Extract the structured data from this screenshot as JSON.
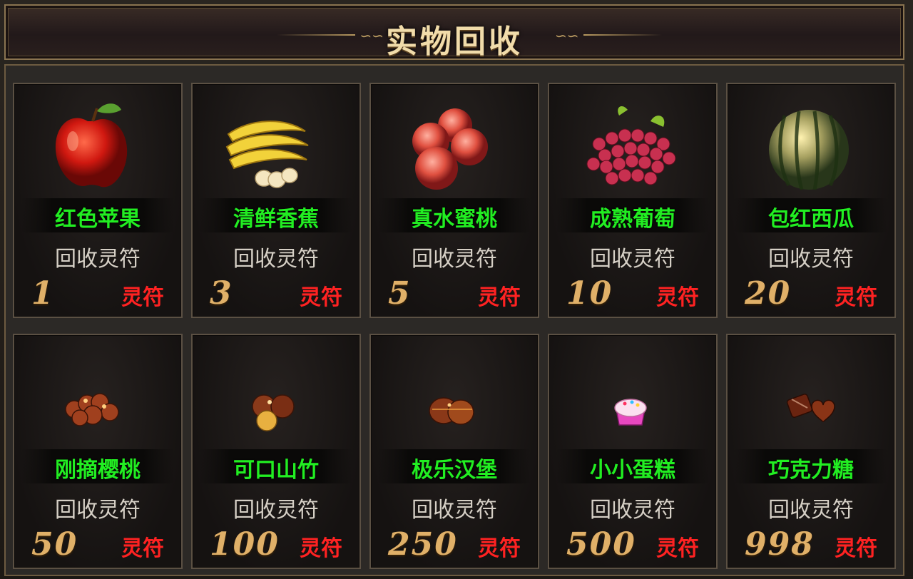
{
  "header": {
    "title": "实物回收"
  },
  "recycle_label": "回收灵符",
  "currency_label": "灵符",
  "items": [
    {
      "name": "红色苹果",
      "price": "1",
      "icon": "apple-icon"
    },
    {
      "name": "清鲜香蕉",
      "price": "3",
      "icon": "banana-icon"
    },
    {
      "name": "真水蜜桃",
      "price": "5",
      "icon": "peach-icon"
    },
    {
      "name": "成熟葡萄",
      "price": "10",
      "icon": "grape-icon"
    },
    {
      "name": "包红西瓜",
      "price": "20",
      "icon": "watermelon-icon"
    },
    {
      "name": "刚摘樱桃",
      "price": "50",
      "icon": "cherry-icon"
    },
    {
      "name": "可口山竹",
      "price": "100",
      "icon": "mangosteen-icon"
    },
    {
      "name": "极乐汉堡",
      "price": "250",
      "icon": "hamburger-icon"
    },
    {
      "name": "小小蛋糕",
      "price": "500",
      "icon": "cake-icon"
    },
    {
      "name": "巧克力糖",
      "price": "998",
      "icon": "chocolate-icon"
    }
  ],
  "colors": {
    "name": "#22ee22",
    "currency": "#ff2222",
    "price": "#e0b068",
    "title": "#f1dcaa"
  }
}
